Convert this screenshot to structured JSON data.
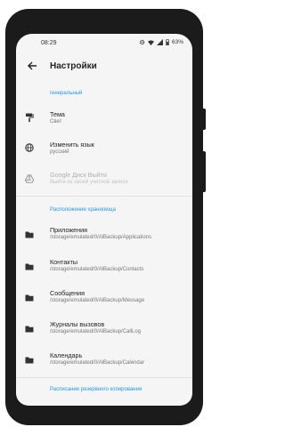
{
  "status": {
    "time": "08:29",
    "battery": "63%"
  },
  "header": {
    "title": "Настройки"
  },
  "sections": {
    "general": "генеральный",
    "storage": "Расположение хранилища",
    "schedule": "Расписание резервного копирования"
  },
  "settings": {
    "theme": {
      "title": "Тема",
      "subtitle": "Свет"
    },
    "language": {
      "title": "Изменить язык",
      "subtitle": "русский"
    },
    "google_drive": {
      "title": "Google Диск Выйти",
      "subtitle": "Выйти из своей учетной записи"
    }
  },
  "storage": [
    {
      "title": "Приложения",
      "path": "/storage/emulated/0/AlBackup/Applications"
    },
    {
      "title": "Контакты",
      "path": "/storage/emulated/0/AlBackup/Contacts"
    },
    {
      "title": "Сообщения",
      "path": "/storage/emulated/0/AlBackup/Message"
    },
    {
      "title": "Журналы вызовов",
      "path": "/storage/emulated/0/AlBackup/CallLog"
    },
    {
      "title": "Календарь",
      "path": "/storage/emulated/0/AlBackup/Calendar"
    }
  ],
  "colors": {
    "accent": "#2196f3",
    "background": "#f5f5f5",
    "frame": "#1b1b1b"
  },
  "icons": {
    "theme": "paint-roller-icon",
    "language": "globe-icon",
    "google_drive": "google-drive-icon",
    "folder": "folder-icon",
    "back": "arrow-back-icon"
  }
}
